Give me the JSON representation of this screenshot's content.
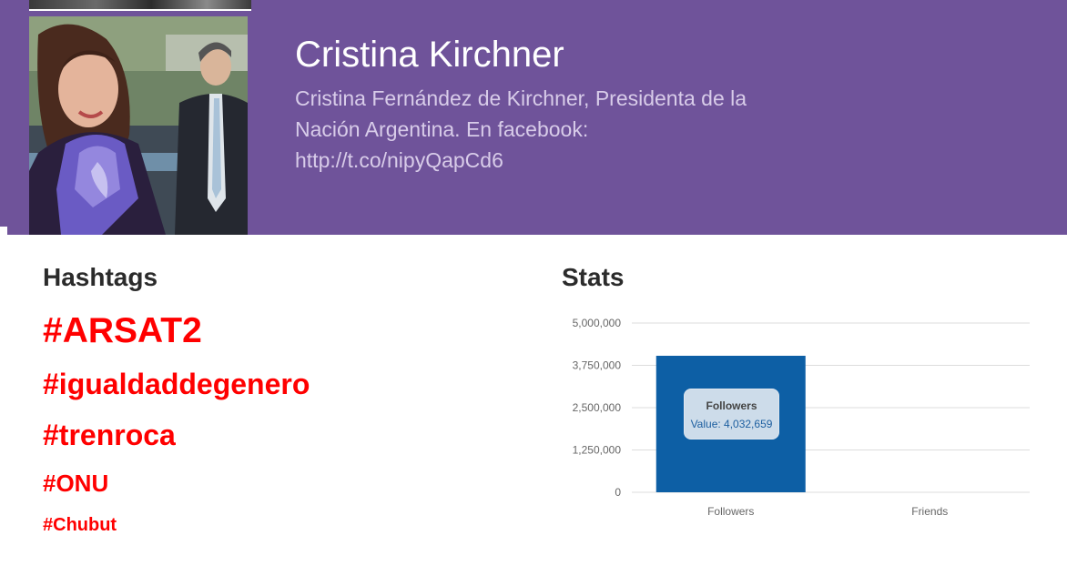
{
  "profile": {
    "name": "Cristina Kirchner",
    "bio_lines": [
      "Cristina Fernández de Kirchner, Presidenta de la",
      "Nación Argentina. En facebook:",
      "http://t.co/nipyQapCd6"
    ]
  },
  "hashtags": {
    "title": "Hashtags",
    "items": [
      "#ARSAT2",
      "#igualdaddegenero",
      "#trenroca",
      "#ONU",
      "#Chubut"
    ]
  },
  "stats": {
    "title": "Stats",
    "tooltip": {
      "title": "Followers",
      "value": "Value: 4,032,659"
    }
  },
  "colors": {
    "header": "#6f539a",
    "hashtag": "#ff0000",
    "bar": "#0d5fa5"
  },
  "chart_data": {
    "type": "bar",
    "categories": [
      "Followers",
      "Friends"
    ],
    "values": [
      4032659,
      0
    ],
    "ylim": [
      0,
      5000000
    ],
    "yticks": [
      0,
      1250000,
      2500000,
      3750000,
      5000000
    ],
    "ytick_labels": [
      "0",
      "1,250,000",
      "2,500,000",
      "3,750,000",
      "5,000,000"
    ],
    "grid": true
  }
}
